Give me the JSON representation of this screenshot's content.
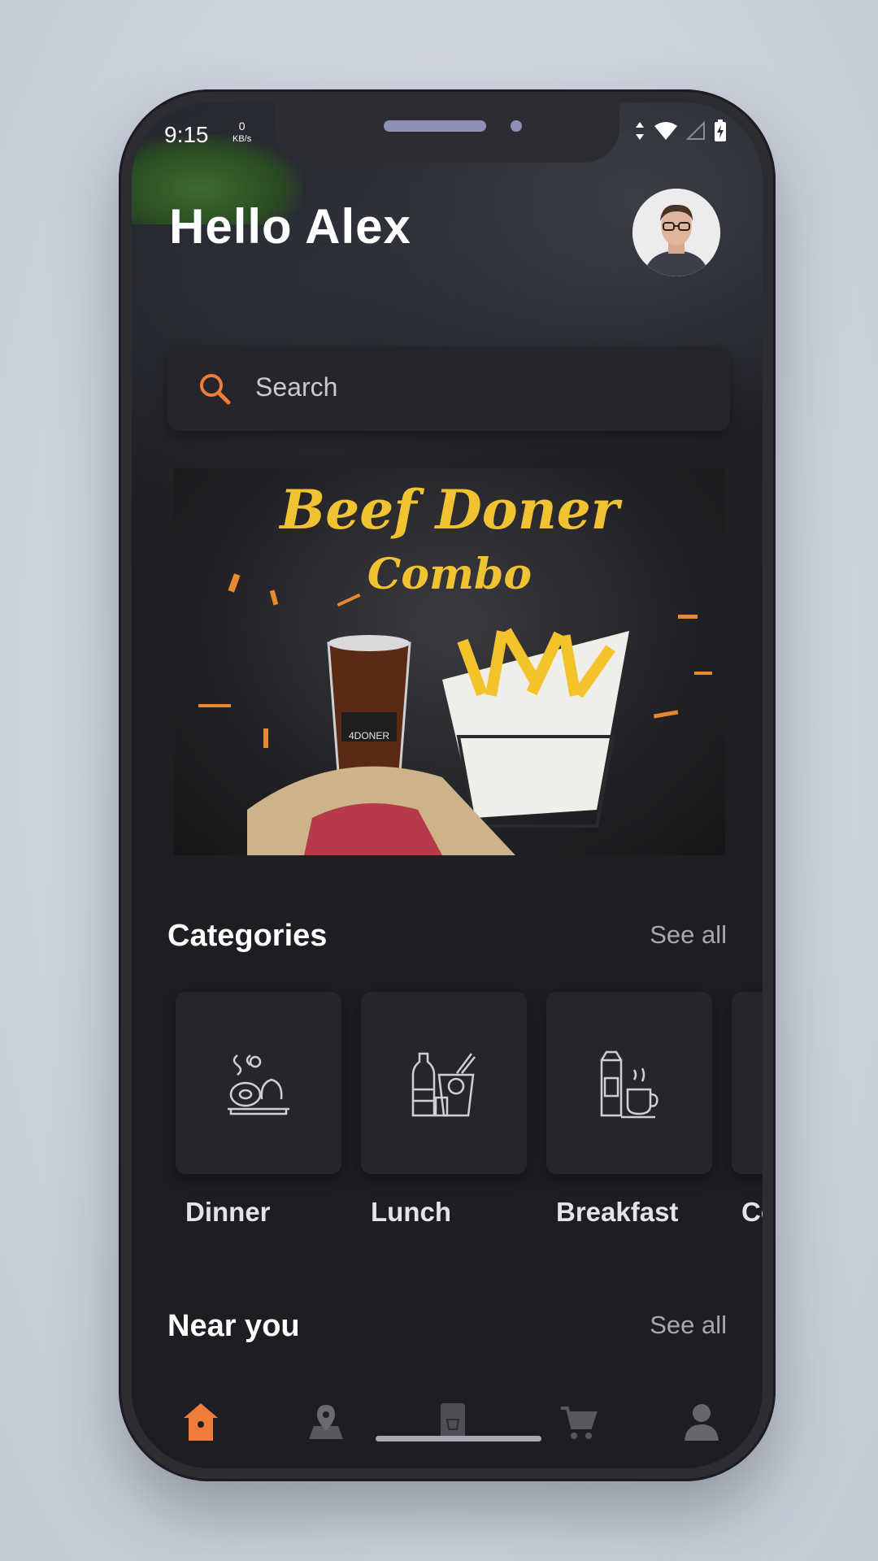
{
  "status_bar": {
    "time": "9:15",
    "net_value": "0",
    "net_unit": "KB/s"
  },
  "header": {
    "greeting": "Hello Alex"
  },
  "search": {
    "placeholder": "Search"
  },
  "banner": {
    "title_line1": "Beef Doner",
    "title_line2": "Combo",
    "brand": "4DONER"
  },
  "categories": {
    "title": "Categories",
    "see_all": "See all",
    "items": [
      {
        "label": "Dinner",
        "icon": "dinner-icon"
      },
      {
        "label": "Lunch",
        "icon": "lunch-icon"
      },
      {
        "label": "Breakfast",
        "icon": "breakfast-icon"
      },
      {
        "label": "Co",
        "icon": "category-icon"
      }
    ]
  },
  "near_you": {
    "title": "Near you",
    "see_all": "See all"
  },
  "bottom_nav": {
    "items": [
      {
        "icon": "home-icon",
        "active": true
      },
      {
        "icon": "map-icon",
        "active": false
      },
      {
        "icon": "menu-icon",
        "active": false
      },
      {
        "icon": "cart-icon",
        "active": false
      },
      {
        "icon": "profile-icon",
        "active": false
      }
    ]
  },
  "colors": {
    "accent": "#f07c3a",
    "background": "#1d1d22",
    "card": "#25252c"
  }
}
